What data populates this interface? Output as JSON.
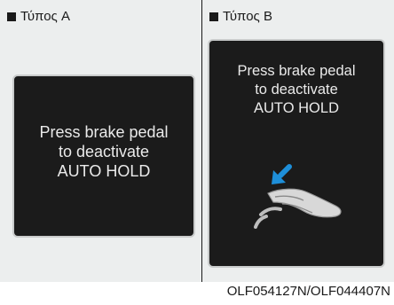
{
  "panel_a": {
    "label": "Τύπος A",
    "message": [
      "Press brake pedal",
      "to deactivate",
      "AUTO HOLD"
    ]
  },
  "panel_b": {
    "label": "Τύπος B",
    "message": [
      "Press brake pedal",
      "to deactivate",
      "AUTO HOLD"
    ],
    "graphic": "foot-on-brake-pedal-icon",
    "arrow_color": "#1e8fd9"
  },
  "footer": {
    "code": "OLF054127N/OLF044407N"
  }
}
